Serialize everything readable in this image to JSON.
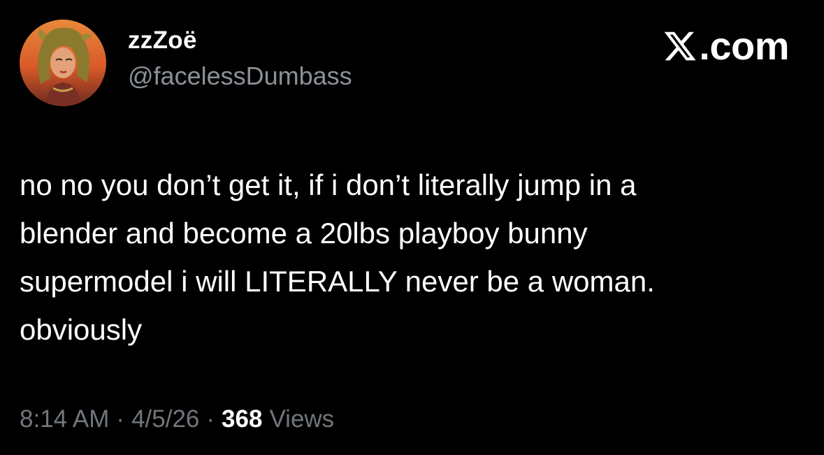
{
  "author": {
    "display_name": "zzZoë",
    "handle": "@facelessDumbass",
    "avatar_icon": "profile-avatar"
  },
  "brand": {
    "icon": "x-logo-icon",
    "text": ".com"
  },
  "tweet": {
    "text": "no no you don’t get it, if i don’t literally jump in a\nblender and become a 20lbs playboy bunny\nsupermodel i will LITERALLY never be a woman.\nobviously"
  },
  "meta": {
    "time": "8:14 AM",
    "separator": "·",
    "date": "4/5/26",
    "views_count": "368",
    "views_label": "Views"
  },
  "colors": {
    "background": "#000000",
    "primary_text": "#ffffff",
    "secondary_text": "#71767b"
  }
}
